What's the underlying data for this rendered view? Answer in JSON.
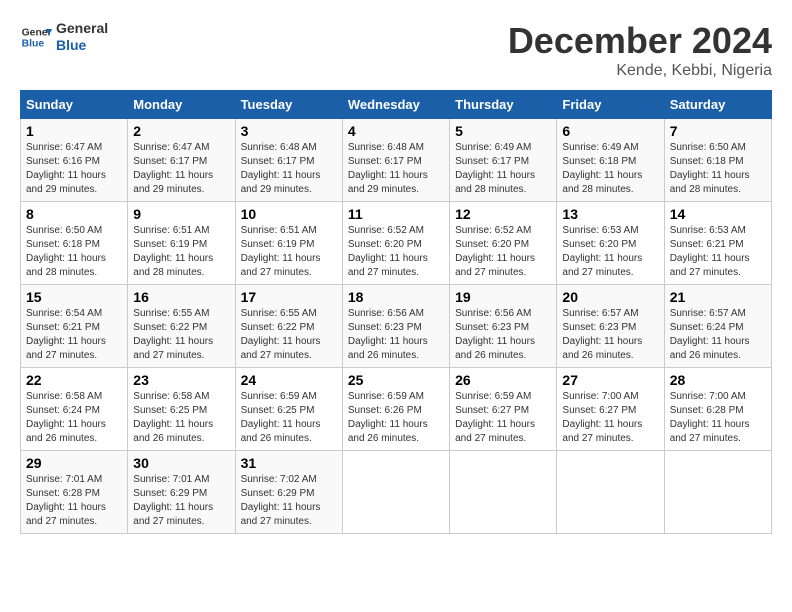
{
  "header": {
    "logo_line1": "General",
    "logo_line2": "Blue",
    "month_title": "December 2024",
    "location": "Kende, Kebbi, Nigeria"
  },
  "days_of_week": [
    "Sunday",
    "Monday",
    "Tuesday",
    "Wednesday",
    "Thursday",
    "Friday",
    "Saturday"
  ],
  "weeks": [
    [
      {
        "num": "1",
        "rise": "6:47 AM",
        "set": "6:16 PM",
        "daylight": "11 hours and 29 minutes."
      },
      {
        "num": "2",
        "rise": "6:47 AM",
        "set": "6:17 PM",
        "daylight": "11 hours and 29 minutes."
      },
      {
        "num": "3",
        "rise": "6:48 AM",
        "set": "6:17 PM",
        "daylight": "11 hours and 29 minutes."
      },
      {
        "num": "4",
        "rise": "6:48 AM",
        "set": "6:17 PM",
        "daylight": "11 hours and 29 minutes."
      },
      {
        "num": "5",
        "rise": "6:49 AM",
        "set": "6:17 PM",
        "daylight": "11 hours and 28 minutes."
      },
      {
        "num": "6",
        "rise": "6:49 AM",
        "set": "6:18 PM",
        "daylight": "11 hours and 28 minutes."
      },
      {
        "num": "7",
        "rise": "6:50 AM",
        "set": "6:18 PM",
        "daylight": "11 hours and 28 minutes."
      }
    ],
    [
      {
        "num": "8",
        "rise": "6:50 AM",
        "set": "6:18 PM",
        "daylight": "11 hours and 28 minutes."
      },
      {
        "num": "9",
        "rise": "6:51 AM",
        "set": "6:19 PM",
        "daylight": "11 hours and 28 minutes."
      },
      {
        "num": "10",
        "rise": "6:51 AM",
        "set": "6:19 PM",
        "daylight": "11 hours and 27 minutes."
      },
      {
        "num": "11",
        "rise": "6:52 AM",
        "set": "6:20 PM",
        "daylight": "11 hours and 27 minutes."
      },
      {
        "num": "12",
        "rise": "6:52 AM",
        "set": "6:20 PM",
        "daylight": "11 hours and 27 minutes."
      },
      {
        "num": "13",
        "rise": "6:53 AM",
        "set": "6:20 PM",
        "daylight": "11 hours and 27 minutes."
      },
      {
        "num": "14",
        "rise": "6:53 AM",
        "set": "6:21 PM",
        "daylight": "11 hours and 27 minutes."
      }
    ],
    [
      {
        "num": "15",
        "rise": "6:54 AM",
        "set": "6:21 PM",
        "daylight": "11 hours and 27 minutes."
      },
      {
        "num": "16",
        "rise": "6:55 AM",
        "set": "6:22 PM",
        "daylight": "11 hours and 27 minutes."
      },
      {
        "num": "17",
        "rise": "6:55 AM",
        "set": "6:22 PM",
        "daylight": "11 hours and 27 minutes."
      },
      {
        "num": "18",
        "rise": "6:56 AM",
        "set": "6:23 PM",
        "daylight": "11 hours and 26 minutes."
      },
      {
        "num": "19",
        "rise": "6:56 AM",
        "set": "6:23 PM",
        "daylight": "11 hours and 26 minutes."
      },
      {
        "num": "20",
        "rise": "6:57 AM",
        "set": "6:23 PM",
        "daylight": "11 hours and 26 minutes."
      },
      {
        "num": "21",
        "rise": "6:57 AM",
        "set": "6:24 PM",
        "daylight": "11 hours and 26 minutes."
      }
    ],
    [
      {
        "num": "22",
        "rise": "6:58 AM",
        "set": "6:24 PM",
        "daylight": "11 hours and 26 minutes."
      },
      {
        "num": "23",
        "rise": "6:58 AM",
        "set": "6:25 PM",
        "daylight": "11 hours and 26 minutes."
      },
      {
        "num": "24",
        "rise": "6:59 AM",
        "set": "6:25 PM",
        "daylight": "11 hours and 26 minutes."
      },
      {
        "num": "25",
        "rise": "6:59 AM",
        "set": "6:26 PM",
        "daylight": "11 hours and 26 minutes."
      },
      {
        "num": "26",
        "rise": "6:59 AM",
        "set": "6:27 PM",
        "daylight": "11 hours and 27 minutes."
      },
      {
        "num": "27",
        "rise": "7:00 AM",
        "set": "6:27 PM",
        "daylight": "11 hours and 27 minutes."
      },
      {
        "num": "28",
        "rise": "7:00 AM",
        "set": "6:28 PM",
        "daylight": "11 hours and 27 minutes."
      }
    ],
    [
      {
        "num": "29",
        "rise": "7:01 AM",
        "set": "6:28 PM",
        "daylight": "11 hours and 27 minutes."
      },
      {
        "num": "30",
        "rise": "7:01 AM",
        "set": "6:29 PM",
        "daylight": "11 hours and 27 minutes."
      },
      {
        "num": "31",
        "rise": "7:02 AM",
        "set": "6:29 PM",
        "daylight": "11 hours and 27 minutes."
      },
      null,
      null,
      null,
      null
    ]
  ]
}
